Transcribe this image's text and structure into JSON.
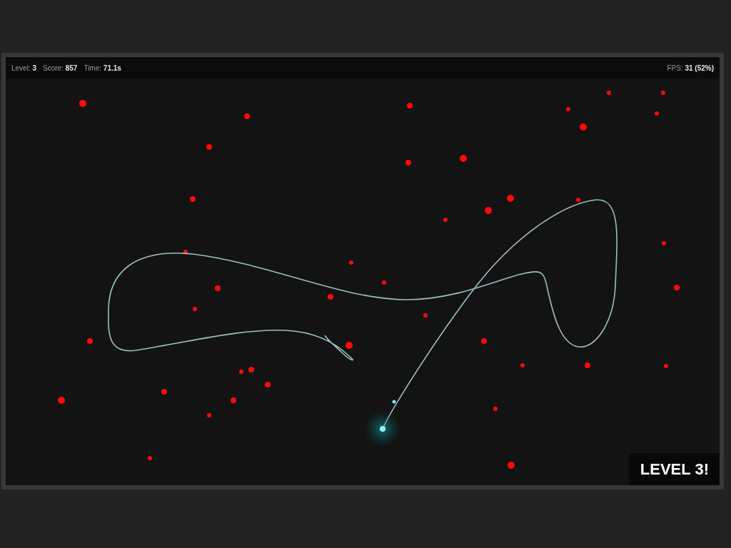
{
  "hud": {
    "stats": [
      {
        "label": "Level:",
        "value": "3"
      },
      {
        "label": "Score:",
        "value": "857"
      },
      {
        "label": "Time:",
        "value": "71.1s"
      }
    ],
    "fps": {
      "label": "FPS:",
      "value": "31 (52%)"
    }
  },
  "banner": "LEVEL 3!"
}
